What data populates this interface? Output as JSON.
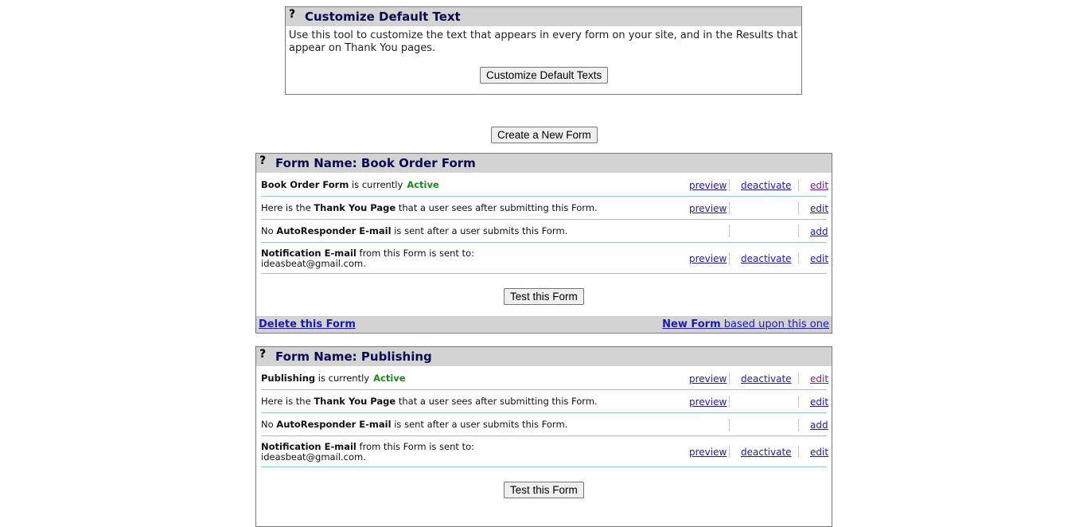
{
  "customize": {
    "title": "Customize Default Text",
    "help_icon": "?",
    "description": "Use this tool to customize the text that appears in every form on your site, and in the Results that appear on Thank You pages.",
    "button": "Customize Default Texts"
  },
  "create_button": "Create a New Form",
  "labels": {
    "form_name_prefix": "Form Name:",
    "is_currently": "is currently",
    "here_is_the": "Here is the",
    "thank_you_page": "Thank You Page",
    "thank_you_suffix": "that a user sees after submitting this Form.",
    "no": "No",
    "autoresponder": "AutoResponder E-mail",
    "autoresponder_suffix": "is sent after a user submits this Form.",
    "notification": "Notification E-mail",
    "notification_suffix": "from this Form is sent to:",
    "preview": "preview",
    "deactivate": "deactivate",
    "edit": "edit",
    "add": "add",
    "test_button": "Test this Form",
    "delete_link": "Delete this Form",
    "new_form_bold": "New Form",
    "new_form_suffix": "based upon this one"
  },
  "forms": [
    {
      "name": "Book Order Form",
      "status": "Active",
      "notify_email": "ideasbeat@gmail.com."
    },
    {
      "name": "Publishing",
      "status": "Active",
      "notify_email": "ideasbeat@gmail.com."
    }
  ],
  "colors": {
    "header_bg": "#d3d3d3",
    "title": "#0a0a50",
    "active": "#1b8a1b",
    "link": "#1a1ab4",
    "row_border": "#9cc3d0"
  }
}
